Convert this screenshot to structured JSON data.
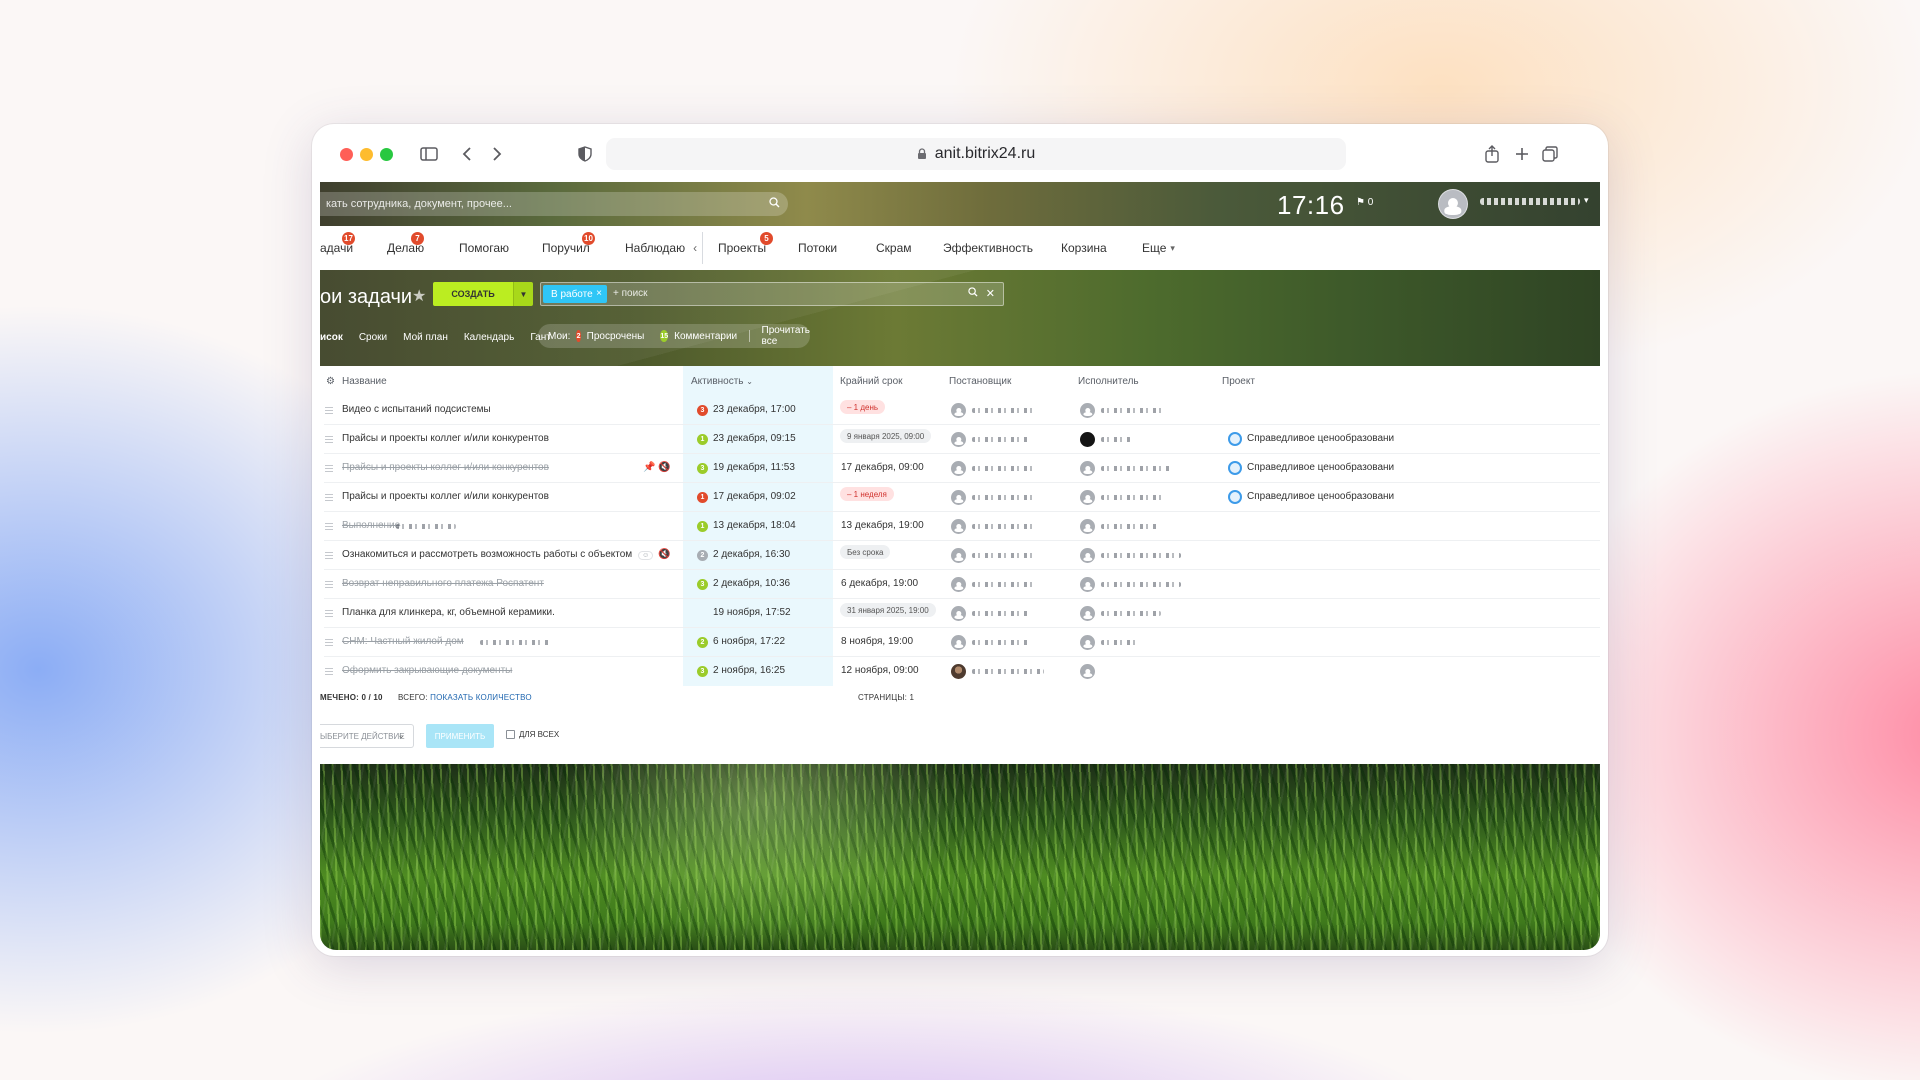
{
  "browser": {
    "url": "anit.bitrix24.ru"
  },
  "header": {
    "search_placeholder": "кать сотрудника, документ, прочее...",
    "time": "17:16",
    "flag_count": "0"
  },
  "nav": [
    {
      "label": "адачи",
      "badge": "17"
    },
    {
      "label": "Делаю",
      "badge": "7"
    },
    {
      "label": "Помогаю",
      "badge": ""
    },
    {
      "label": "Поручил",
      "badge": "10"
    },
    {
      "label": "Наблюдаю",
      "badge": ""
    },
    {
      "label": "Проекты",
      "badge": "5"
    },
    {
      "label": "Потоки",
      "badge": ""
    },
    {
      "label": "Скрам",
      "badge": ""
    },
    {
      "label": "Эффективность",
      "badge": ""
    },
    {
      "label": "Корзина",
      "badge": ""
    },
    {
      "label": "Еще",
      "badge": ""
    }
  ],
  "toolbar": {
    "title": "ои задачи",
    "create_label": "СОЗДАТЬ",
    "filter_chip": "В работе",
    "filter_placeholder": "+ поиск"
  },
  "views": [
    "исок",
    "Сроки",
    "Мой план",
    "Календарь",
    "Гант"
  ],
  "counters": {
    "label": "Мои:",
    "overdue_count": "2",
    "overdue_label": "Просрочены",
    "comments_count": "15",
    "comments_label": "Комментарии",
    "read_all": "Прочитать все"
  },
  "columns": {
    "name": "Название",
    "activity": "Активность",
    "deadline": "Крайний срок",
    "creator": "Постановщик",
    "responsible": "Исполнитель",
    "project": "Проект"
  },
  "rows": [
    {
      "title": "Видео с испытаний подсистемы",
      "done": false,
      "activity_count": "3",
      "activity_color": "#e14b2c",
      "activity": "23 декабря, 17:00",
      "deadline_text": "",
      "deadline_pill": "– 1 день",
      "pill_style": "red",
      "project": ""
    },
    {
      "title": "Прайсы и проекты коллег и/или конкурентов",
      "done": false,
      "activity_count": "1",
      "activity_color": "#9bcc2a",
      "activity": "23 декабря, 09:15",
      "deadline_text": "",
      "deadline_pill": "9 января 2025, 09:00",
      "pill_style": "gray",
      "project": "Справедливое ценообразовани"
    },
    {
      "title": "Прайсы и проекты коллег и/или конкурентов",
      "done": true,
      "activity_count": "3",
      "activity_color": "#9bcc2a",
      "activity": "19 декабря, 11:53",
      "deadline_text": "17 декабря, 09:00",
      "deadline_pill": "",
      "pill_style": "",
      "project": "Справедливое ценообразовани"
    },
    {
      "title": "Прайсы и проекты коллег и/или конкурентов",
      "done": false,
      "activity_count": "1",
      "activity_color": "#e14b2c",
      "activity": "17 декабря, 09:02",
      "deadline_text": "",
      "deadline_pill": "– 1 неделя",
      "pill_style": "red",
      "project": "Справедливое ценообразовани"
    },
    {
      "title": "Выполнение",
      "done": true,
      "activity_count": "1",
      "activity_color": "#9bcc2a",
      "activity": "13 декабря, 18:04",
      "deadline_text": "13 декабря, 19:00",
      "deadline_pill": "",
      "pill_style": "",
      "project": ""
    },
    {
      "title": "Ознакомиться и рассмотреть возможность работы с объектом",
      "done": false,
      "activity_count": "2",
      "activity_color": "#a8adb3",
      "activity": "2 декабря, 16:30",
      "deadline_text": "",
      "deadline_pill": "Без срока",
      "pill_style": "gray",
      "project": ""
    },
    {
      "title": "Возврат неправильного платежа Роспатент",
      "done": true,
      "activity_count": "3",
      "activity_color": "#9bcc2a",
      "activity": "2 декабря, 10:36",
      "deadline_text": "6 декабря, 19:00",
      "deadline_pill": "",
      "pill_style": "",
      "project": ""
    },
    {
      "title": "Планка для клинкера, кг, объемной керамики.",
      "done": false,
      "activity_count": "",
      "activity_color": "",
      "activity": "19 ноября, 17:52",
      "deadline_text": "",
      "deadline_pill": "31 января 2025, 19:00",
      "pill_style": "gray",
      "project": ""
    },
    {
      "title": "СНМ: Частный жилой дом",
      "done": true,
      "activity_count": "2",
      "activity_color": "#9bcc2a",
      "activity": "6 ноября, 17:22",
      "deadline_text": "8 ноября, 19:00",
      "deadline_pill": "",
      "pill_style": "",
      "project": ""
    },
    {
      "title": "Оформить закрывающие документы",
      "done": true,
      "activity_count": "3",
      "activity_color": "#9bcc2a",
      "activity": "2 ноября, 16:25",
      "deadline_text": "12 ноября, 09:00",
      "deadline_pill": "",
      "pill_style": "",
      "project": ""
    }
  ],
  "footer": {
    "selected_label": "МЕЧЕНО:",
    "selected_value": "0 / 10",
    "total_label": "ВСЕГО:",
    "total_link": "ПОКАЗАТЬ КОЛИЧЕСТВО",
    "pages_label": "СТРАНИЦЫ: 1",
    "action_placeholder": "ЫБЕРИТЕ ДЕЙСТВИЕ",
    "apply_label": "ПРИМЕНИТЬ",
    "for_all_label": "ДЛЯ ВСЕХ"
  }
}
